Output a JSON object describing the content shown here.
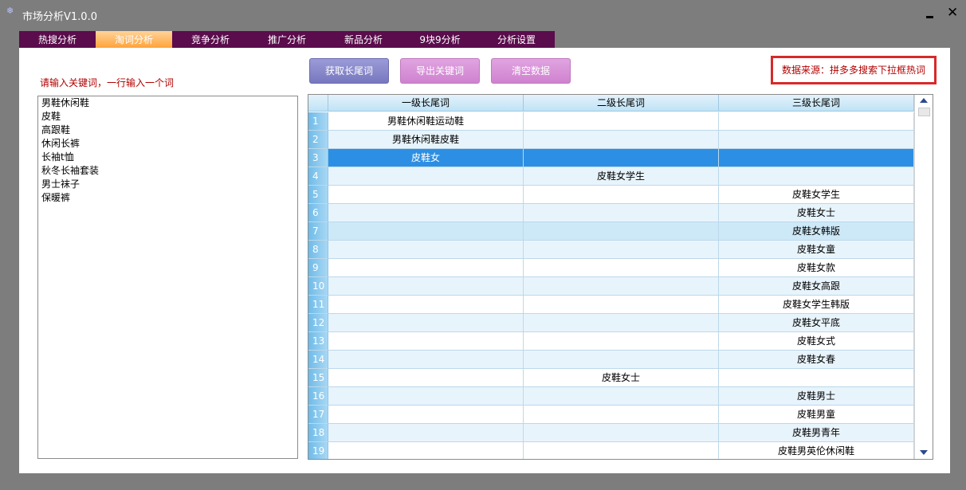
{
  "window": {
    "title": "市场分析V1.0.0"
  },
  "tabs": [
    {
      "label": "热搜分析"
    },
    {
      "label": "淘词分析"
    },
    {
      "label": "竞争分析"
    },
    {
      "label": "推广分析"
    },
    {
      "label": "新品分析"
    },
    {
      "label": "9块9分析"
    },
    {
      "label": "分析设置"
    }
  ],
  "active_tab": "淘词分析",
  "left_panel": {
    "prompt": "请输入关键词，一行输入一个词",
    "keywords": [
      "男鞋休闲鞋",
      "皮鞋",
      "高跟鞋",
      "休闲长裤",
      "长袖t恤",
      "秋冬长袖套装",
      "男士袜子",
      "保暖裤"
    ]
  },
  "toolbar": {
    "get_label": "获取长尾词",
    "export_label": "导出关键词",
    "clear_label": "清空数据"
  },
  "source_note": "数据来源：拼多多搜索下拉框热词",
  "grid": {
    "columns": [
      "一级长尾词",
      "二级长尾词",
      "三级长尾词"
    ],
    "selected_row": 3,
    "rows": [
      {
        "n": "1",
        "c1": "男鞋休闲鞋运动鞋",
        "c2": "",
        "c3": ""
      },
      {
        "n": "2",
        "c1": "男鞋休闲鞋皮鞋",
        "c2": "",
        "c3": ""
      },
      {
        "n": "3",
        "c1": "皮鞋女",
        "c2": "",
        "c3": ""
      },
      {
        "n": "4",
        "c1": "",
        "c2": "皮鞋女学生",
        "c3": ""
      },
      {
        "n": "5",
        "c1": "",
        "c2": "",
        "c3": "皮鞋女学生"
      },
      {
        "n": "6",
        "c1": "",
        "c2": "",
        "c3": "皮鞋女士"
      },
      {
        "n": "7",
        "c1": "",
        "c2": "",
        "c3": "皮鞋女韩版"
      },
      {
        "n": "8",
        "c1": "",
        "c2": "",
        "c3": "皮鞋女童"
      },
      {
        "n": "9",
        "c1": "",
        "c2": "",
        "c3": "皮鞋女款"
      },
      {
        "n": "10",
        "c1": "",
        "c2": "",
        "c3": "皮鞋女高跟"
      },
      {
        "n": "11",
        "c1": "",
        "c2": "",
        "c3": "皮鞋女学生韩版"
      },
      {
        "n": "12",
        "c1": "",
        "c2": "",
        "c3": "皮鞋女平底"
      },
      {
        "n": "13",
        "c1": "",
        "c2": "",
        "c3": "皮鞋女式"
      },
      {
        "n": "14",
        "c1": "",
        "c2": "",
        "c3": "皮鞋女春"
      },
      {
        "n": "15",
        "c1": "",
        "c2": "皮鞋女士",
        "c3": ""
      },
      {
        "n": "16",
        "c1": "",
        "c2": "",
        "c3": "皮鞋男士"
      },
      {
        "n": "17",
        "c1": "",
        "c2": "",
        "c3": "皮鞋男童"
      },
      {
        "n": "18",
        "c1": "",
        "c2": "",
        "c3": "皮鞋男青年"
      },
      {
        "n": "19",
        "c1": "",
        "c2": "",
        "c3": "皮鞋男英伦休闲鞋"
      }
    ]
  },
  "colors": {
    "tab_bar": "#5a0c4c",
    "active_tab": "#ffa33a",
    "selected_row": "#2d8fe3",
    "source_border": "#d62a2a"
  }
}
